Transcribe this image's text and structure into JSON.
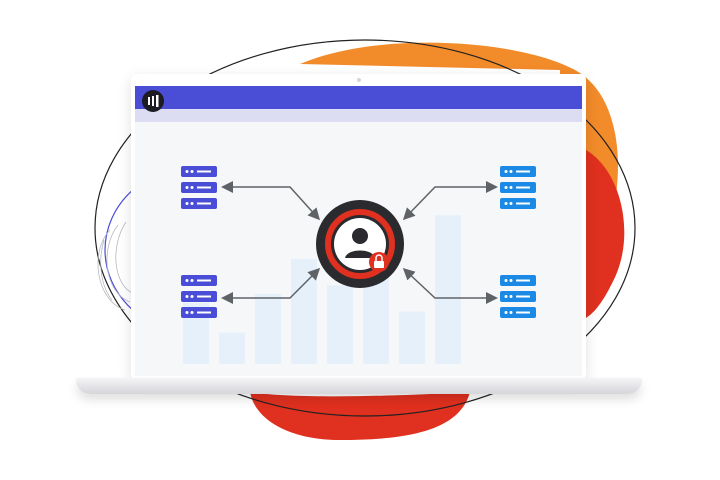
{
  "colors": {
    "header": "#4a4ed6",
    "subheader": "#dcdcf3",
    "server_left": "#4a4ed6",
    "server_right": "#1a8ae6",
    "accent_red": "#e0301f",
    "accent_orange": "#f28b2a",
    "bars": "#e6f0fb",
    "arrows": "#5f6368"
  },
  "icons": {
    "logo": "bars-logo-icon",
    "center": "locked-user-icon",
    "servers": "server-rack-icon",
    "lock": "padlock-icon"
  },
  "bars": [
    0.35,
    0.18,
    0.4,
    0.6,
    0.45,
    0.7,
    0.3,
    0.85
  ]
}
